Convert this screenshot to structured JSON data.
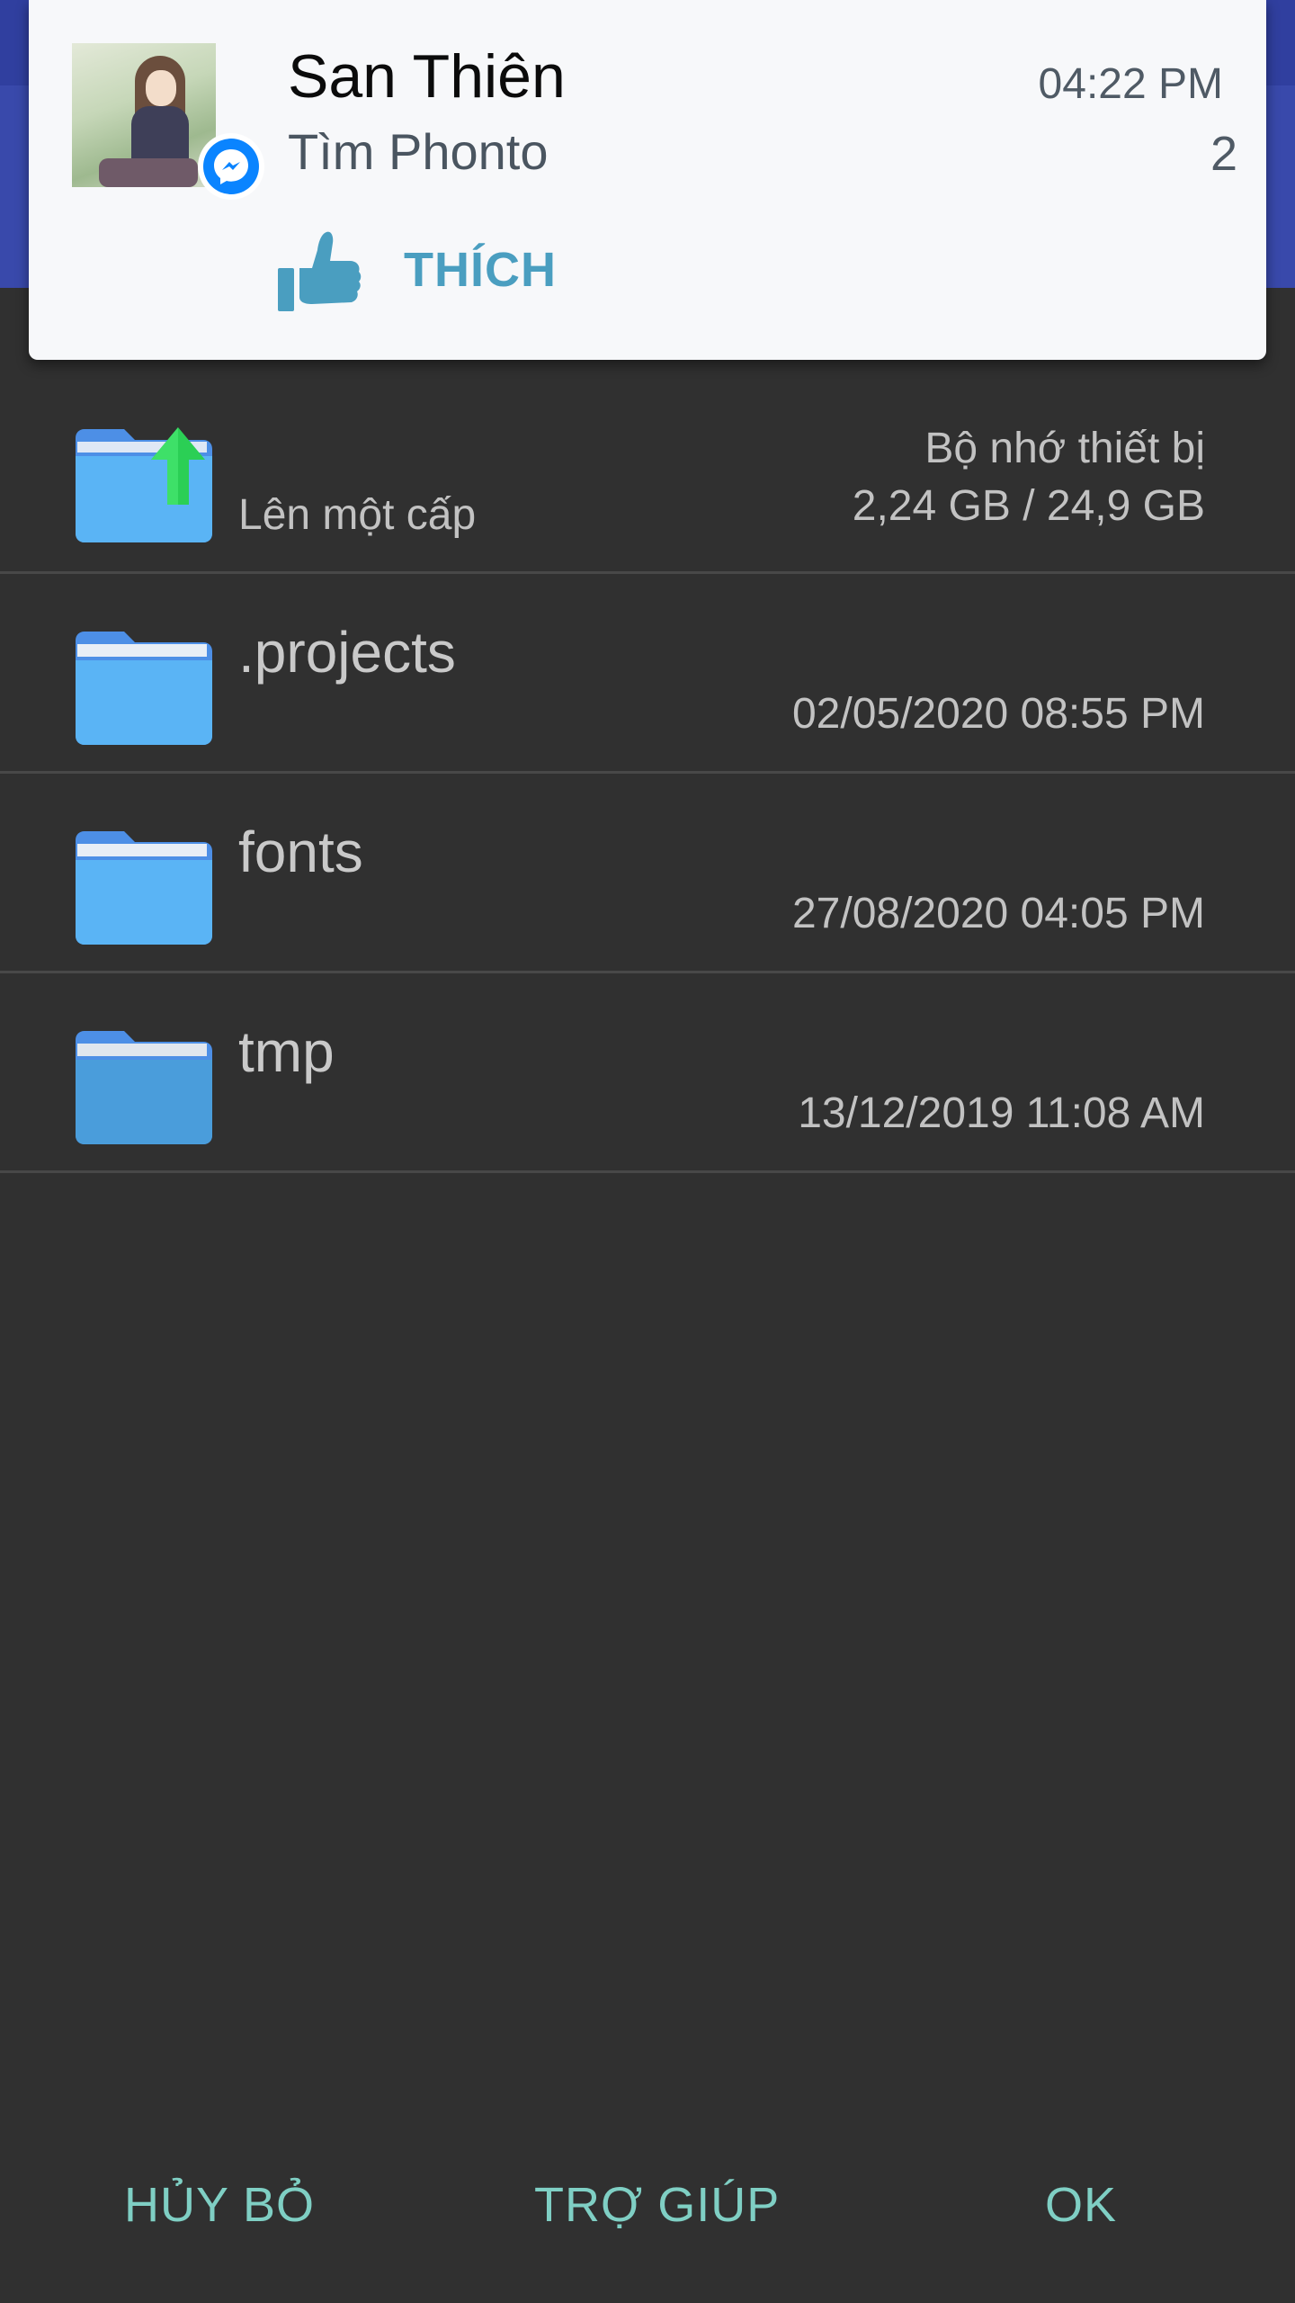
{
  "notification": {
    "sender": "San Thiên",
    "message": "Tìm Phonto",
    "time": "04:22 PM",
    "count": "2",
    "action_label": "THÍCH",
    "app_icon": "messenger-icon",
    "action_icon": "thumbs-up-icon"
  },
  "file_list": {
    "up_item": {
      "label": "Lên một cấp",
      "storage_label": "Bộ nhớ thiết bị",
      "storage_size": "2,24 GB / 24,9 GB",
      "icon": "folder-up-icon"
    },
    "folders": [
      {
        "name": ".projects",
        "date": "02/05/2020 08:55 PM",
        "icon": "folder-icon"
      },
      {
        "name": "fonts",
        "date": "27/08/2020 04:05 PM",
        "icon": "folder-icon"
      },
      {
        "name": "tmp",
        "date": "13/12/2019 11:08 AM",
        "icon": "folder-icon"
      }
    ]
  },
  "buttons": {
    "cancel": "HỦY BỎ",
    "help": "TRỢ GIÚP",
    "ok": "OK"
  },
  "colors": {
    "background": "#303030",
    "accent": "#7fcfc4",
    "app_bar": "#3949ab",
    "folder": "#5ab4f5",
    "like": "#4a9ec0"
  }
}
